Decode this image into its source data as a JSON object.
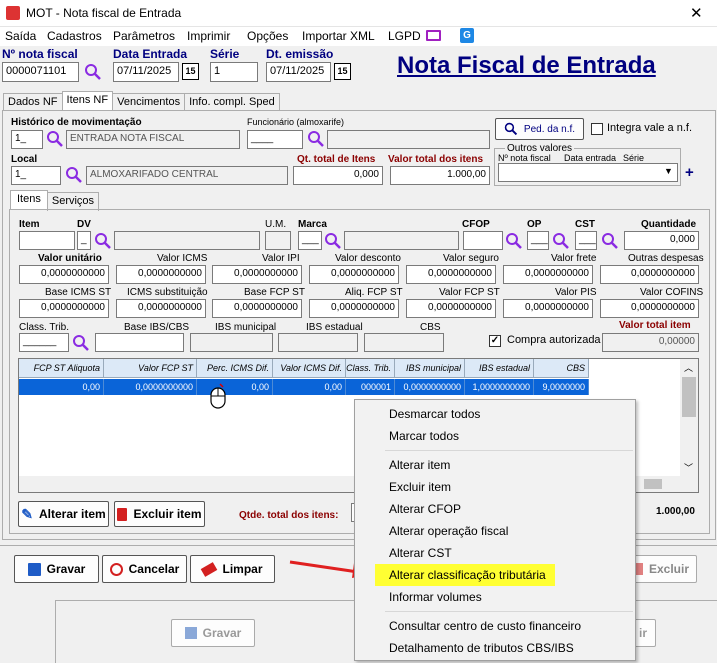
{
  "window": {
    "title": "MOT - Nota fiscal de Entrada",
    "close": "✕"
  },
  "menubar": [
    "Saída",
    "Cadastros",
    "Parâmetros",
    "Imprimir",
    "Opções",
    "Importar XML",
    "LGPD"
  ],
  "header": {
    "nota_label": "Nº nota fiscal",
    "nota_value": "0000071101",
    "data_entrada_label": "Data Entrada",
    "data_entrada_value": "07/11/2025",
    "serie_label": "Série",
    "serie_value": "1",
    "dt_emissao_label": "Dt. emissão",
    "dt_emissao_value": "07/11/2025",
    "cal_icon": "15",
    "page_title": "Nota Fiscal de Entrada"
  },
  "main_tabs": [
    "Dados NF",
    "Itens NF",
    "Vencimentos",
    "Info. compl. Sped"
  ],
  "itens_nf": {
    "historico_label": "Histórico de movimentação",
    "historico_code": "1_",
    "historico_name": "ENTRADA NOTA FISCAL",
    "funcionario_label": "Funcionário (almoxarife)",
    "funcionario_code": "____",
    "ped_nf_button": "Ped. da n.f.",
    "integra_label": "Integra vale a n.f.",
    "local_label": "Local",
    "local_code": "1_",
    "local_name": "ALMOXARIFADO CENTRAL",
    "qt_total_label": "Qt. total de Itens",
    "qt_total_value": "0,000",
    "valor_total_label": "Valor total dos itens",
    "valor_total_value": "1.000,00",
    "outros_valores_title": "Outros valores",
    "outros_cols": [
      "Nº nota fiscal",
      "Data entrada",
      "Série"
    ],
    "plus": "+"
  },
  "inner_tabs": [
    "Itens",
    "Serviços"
  ],
  "item": {
    "item_label": "Item",
    "dv_label": "DV",
    "dv_value": "_",
    "um_label": "U.M.",
    "marca_label": "Marca",
    "marca_value": "___",
    "cfop_label": "CFOP",
    "op_label": "OP",
    "op_value": "___",
    "cst_label": "CST",
    "cst_value": "___",
    "quantidade_label": "Quantidade",
    "quantidade_value": "0,000",
    "row2": [
      {
        "label": "Valor unitário",
        "value": "0,0000000000"
      },
      {
        "label": "Valor ICMS",
        "value": "0,0000000000"
      },
      {
        "label": "Valor IPI",
        "value": "0,0000000000"
      },
      {
        "label": "Valor desconto",
        "value": "0,0000000000"
      },
      {
        "label": "Valor seguro",
        "value": "0,0000000000"
      },
      {
        "label": "Valor frete",
        "value": "0,0000000000"
      },
      {
        "label": "Outras despesas",
        "value": "0,0000000000"
      }
    ],
    "row3": [
      {
        "label": "Base ICMS ST",
        "value": "0,0000000000"
      },
      {
        "label": "ICMS substituição",
        "value": "0,0000000000"
      },
      {
        "label": "Base FCP ST",
        "value": "0,0000000000"
      },
      {
        "label": "Aliq. FCP ST",
        "value": "0,0000000000"
      },
      {
        "label": "Valor FCP ST",
        "value": "0,0000000000"
      },
      {
        "label": "Valor PIS",
        "value": "0,0000000000"
      },
      {
        "label": "Valor COFINS",
        "value": "0,0000000000"
      }
    ],
    "class_trib_label": "Class. Trib.",
    "class_trib_value": "______",
    "base_ibs_label": "Base IBS/CBS",
    "ibs_mun_label": "IBS municipal",
    "ibs_est_label": "IBS estadual",
    "cbs_label": "CBS",
    "compra_autorizada_label": "Compra autorizada",
    "valor_total_item_label": "Valor total item",
    "valor_total_item_value": "0,00000"
  },
  "grid": {
    "headers": [
      "FCP ST Aliquota",
      "Valor FCP ST",
      "Perc. ICMS Dif.",
      "Valor ICMS Dif.",
      "Class. Trib.",
      "IBS municipal",
      "IBS estadual",
      "CBS"
    ],
    "row": [
      "0,00",
      "0,0000000000",
      "0,00",
      "0,00",
      "000001",
      "0,0000000000",
      "1,0000000000",
      "9,0000000"
    ]
  },
  "bottom": {
    "alterar_item": "Alterar item",
    "excluir_item": "Excluir item",
    "qtde_total_label": "Qtde. total dos itens:",
    "total_value": "1.000,00"
  },
  "actions": {
    "gravar": "Gravar",
    "cancelar": "Cancelar",
    "limpar": "Limpar",
    "excluir": "Excluir",
    "gravar2": "Gravar",
    "partial_right": "ir"
  },
  "context_menu": {
    "group1": [
      "Desmarcar todos",
      "Marcar todos"
    ],
    "group2": [
      "Alterar item",
      "Excluir item",
      "Alterar CFOP",
      "Alterar operação fiscal",
      "Alterar CST",
      "Alterar classificação tributária",
      "Informar volumes"
    ],
    "group3": [
      "Consultar centro de custo financeiro",
      "Detalhamento de tributos CBS/IBS"
    ],
    "highlighted": "Alterar classificação tributária"
  },
  "colors": {
    "accent": "#000080",
    "highlight": "#ffff33",
    "grid_select": "#0a64d8",
    "red_label": "#8b0000",
    "arrow": "#e02020"
  }
}
